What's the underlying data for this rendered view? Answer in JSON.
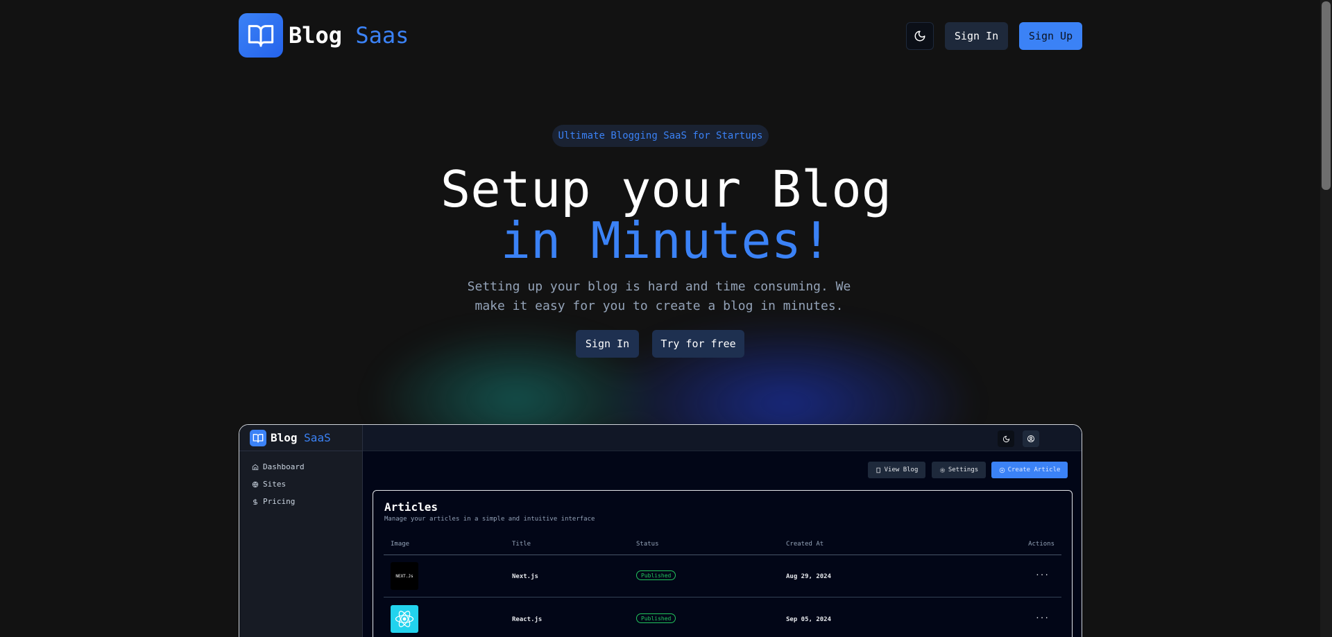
{
  "header": {
    "logo_word1": "Blog",
    "logo_word2": "Saas",
    "sign_in": "Sign In",
    "sign_up": "Sign Up",
    "logo_icon": "book-open-icon",
    "theme_icon": "moon-icon"
  },
  "hero": {
    "badge": "Ultimate Blogging SaaS for Startups",
    "title_line1": "Setup your Blog",
    "title_line2": "in Minutes!",
    "subtitle": "Setting up your blog is hard and time consuming. We make it easy for you to create a blog in minutes.",
    "sign_in": "Sign In",
    "try_free": "Try for free"
  },
  "preview": {
    "logo_word1": "Blog",
    "logo_word2": "SaaS",
    "nav": [
      {
        "label": "Dashboard",
        "icon": "home-icon"
      },
      {
        "label": "Sites",
        "icon": "globe-icon"
      },
      {
        "label": "Pricing",
        "icon": "dollar-icon"
      }
    ],
    "actions": {
      "view_blog": "View Blog",
      "settings": "Settings",
      "create_article": "Create Article"
    },
    "articles": {
      "title": "Articles",
      "description": "Manage your articles in a simple and intuitive interface",
      "columns": [
        "Image",
        "Title",
        "Status",
        "Created At",
        "Actions"
      ],
      "rows": [
        {
          "title": "Next.js",
          "status": "Published",
          "created_at": "Aug 29, 2024",
          "thumb_text": "NEXT.Js",
          "actions": "···"
        },
        {
          "title": "React.js",
          "status": "Published",
          "created_at": "Sep 05, 2024",
          "thumb_text": "",
          "actions": "···"
        }
      ]
    }
  },
  "colors": {
    "background": "#121212",
    "accent": "#3b82f6",
    "muted_text": "#94a3b8",
    "published": "#22c55e"
  }
}
